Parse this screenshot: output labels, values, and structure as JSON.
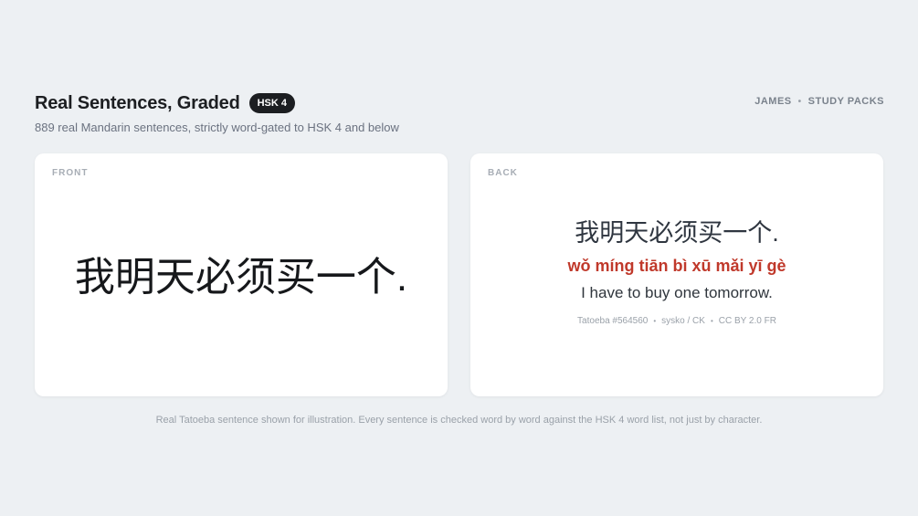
{
  "header": {
    "title": "Real Sentences, Graded",
    "badge": "HSK 4",
    "subtitle": "889 real Mandarin sentences, strictly word-gated to HSK 4 and below"
  },
  "nav": {
    "user": "JAMES",
    "separator": "•",
    "study_packs": "STUDY PACKS"
  },
  "front_card": {
    "label": "FRONT",
    "hanzi": "我明天必须买一个."
  },
  "back_card": {
    "label": "BACK",
    "hanzi": "我明天必须买一个.",
    "pinyin": "wǒ míng tiān bì xū mǎi yī gè",
    "translation": "I have to buy one tomorrow.",
    "meta": {
      "source": "Tatoeba #564560",
      "author": "sysko / CK",
      "license": "CC BY 2.0 FR",
      "separator": "•"
    }
  },
  "footer": {
    "note": "Real Tatoeba sentence shown for illustration. Every sentence is checked word by word against the HSK 4 word list, not just by character."
  },
  "colors": {
    "background": "#edf0f3",
    "card": "#ffffff",
    "badge": "#1c1e21",
    "pinyin": "#c0392b"
  }
}
